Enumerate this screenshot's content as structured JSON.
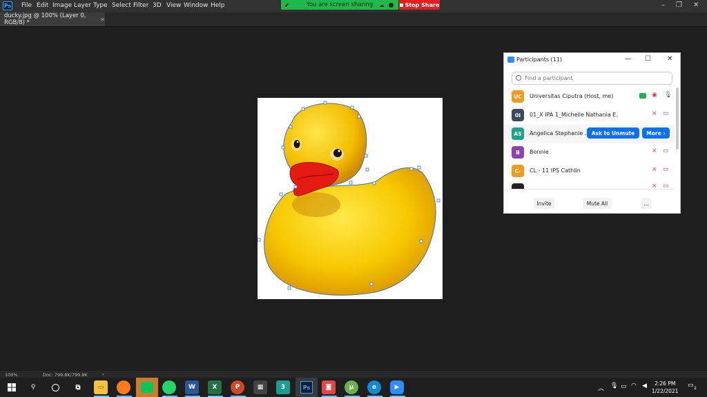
{
  "app": {
    "menu": [
      "File",
      "Edit",
      "Image",
      "Layer",
      "Type",
      "Select",
      "Filter",
      "3D",
      "View",
      "Window",
      "Help"
    ],
    "logo": "Ps"
  },
  "share": {
    "status": "You are screen sharing",
    "stop_label": "Stop Share"
  },
  "document": {
    "tab_title": "ducky.jpg @ 100% (Layer 0, RGB/8) *"
  },
  "status": {
    "zoom": "100%",
    "doc_size": "Doc: 799.8K/799.8K"
  },
  "participants": {
    "title": "Participants (11)",
    "search_placeholder": "Find a participant",
    "rows": [
      {
        "initials": "UC",
        "name": "Universitas Ciputra (Host, me)",
        "color": "#f39a1c"
      },
      {
        "initials": "0I",
        "name": "01_X IPA 1_Michelle Nathania E.",
        "color": "#3b4a5c"
      },
      {
        "initials": "AS",
        "name": "Angelica Stephanie ...",
        "color": "#1aa38a"
      },
      {
        "initials": "B",
        "name": "Bonnie",
        "color": "#8e44ad"
      },
      {
        "initials": "C-",
        "name": "CL - 11 IPS Cathlin",
        "color": "#f39a1c"
      }
    ],
    "ask_unmute": "Ask to Unmute",
    "more": "More",
    "invite": "Invite",
    "mute_all": "Mute All",
    "ellipsis": "..."
  },
  "taskbar": {
    "time": "2:26 PM",
    "date": "1/22/2021",
    "notifications": "2"
  }
}
